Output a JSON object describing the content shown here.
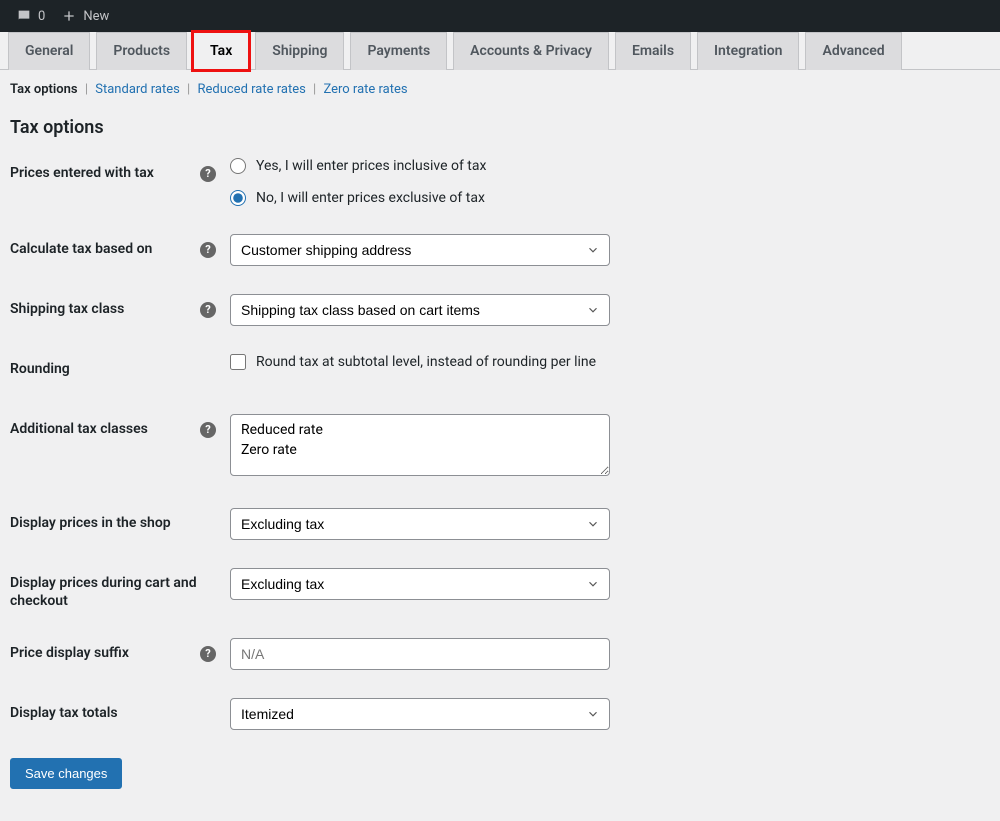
{
  "admin_bar": {
    "comments_count": "0",
    "new_label": "New"
  },
  "tabs": [
    {
      "label": "General"
    },
    {
      "label": "Products"
    },
    {
      "label": "Tax",
      "active": true
    },
    {
      "label": "Shipping"
    },
    {
      "label": "Payments"
    },
    {
      "label": "Accounts & Privacy"
    },
    {
      "label": "Emails"
    },
    {
      "label": "Integration"
    },
    {
      "label": "Advanced"
    }
  ],
  "subnav": {
    "current": "Tax options",
    "links": [
      "Standard rates",
      "Reduced rate rates",
      "Zero rate rates"
    ]
  },
  "section_title": "Tax options",
  "fields": {
    "prices_entered": {
      "label": "Prices entered with tax",
      "opt_yes": "Yes, I will enter prices inclusive of tax",
      "opt_no": "No, I will enter prices exclusive of tax"
    },
    "calc_based": {
      "label": "Calculate tax based on",
      "value": "Customer shipping address"
    },
    "ship_class": {
      "label": "Shipping tax class",
      "value": "Shipping tax class based on cart items"
    },
    "rounding": {
      "label": "Rounding",
      "text": "Round tax at subtotal level, instead of rounding per line"
    },
    "additional": {
      "label": "Additional tax classes",
      "value": "Reduced rate\nZero rate"
    },
    "display_shop": {
      "label": "Display prices in the shop",
      "value": "Excluding tax"
    },
    "display_cart": {
      "label": "Display prices during cart and checkout",
      "value": "Excluding tax"
    },
    "suffix": {
      "label": "Price display suffix",
      "placeholder": "N/A"
    },
    "totals": {
      "label": "Display tax totals",
      "value": "Itemized"
    }
  },
  "save_label": "Save changes"
}
